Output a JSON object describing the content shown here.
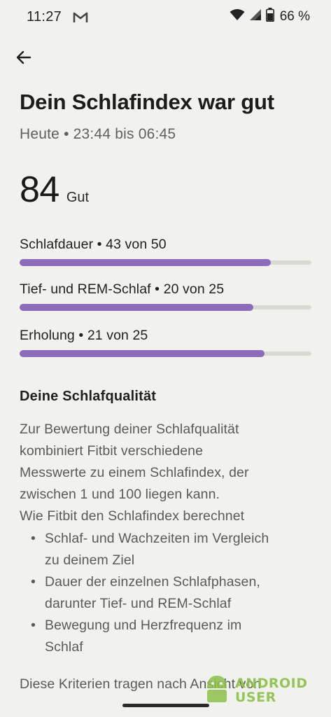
{
  "status_bar": {
    "time": "11:27",
    "battery_percent": "66 %",
    "icons": [
      "gmail-icon",
      "wifi-icon",
      "signal-icon",
      "battery-icon"
    ]
  },
  "header": {
    "back_icon": "arrow-back-icon",
    "title": "Dein Schlafindex war gut",
    "subtitle": "Heute • 23:44 bis 06:45"
  },
  "score": {
    "value": "84",
    "label": "Gut"
  },
  "metrics": [
    {
      "label": "Schlafdauer • 43 von 50",
      "score": 43,
      "max": 50
    },
    {
      "label": "Tief- und REM-Schlaf • 20 von 25",
      "score": 20,
      "max": 25
    },
    {
      "label": "Erholung • 21 von 25",
      "score": 21,
      "max": 25
    }
  ],
  "quality": {
    "heading": "Deine Schlafqualität",
    "lines": [
      "Zur Bewertung deiner Schlafqualität",
      "kombiniert Fitbit verschiedene",
      "Messwerte zu einem Schlafindex, der",
      "zwischen 1 und 100 liegen kann.",
      "Wie Fitbit den Schlafindex berechnet"
    ],
    "bullets": [
      [
        "Schlaf- und Wachzeiten im Vergleich",
        "zu deinem Ziel"
      ],
      [
        "Dauer der einzelnen Schlafphasen,",
        "darunter Tief- und REM-Schlaf"
      ],
      [
        "Bewegung und Herzfrequenz im",
        "Schlaf"
      ]
    ],
    "footer": "Diese Kriterien tragen nach Ansicht von"
  },
  "watermark": {
    "line1": "ANDROID",
    "line2": "USER"
  },
  "colors": {
    "background": "#f1f2ed",
    "accent_purple": "#8e6bb8",
    "track": "#d9dad4",
    "watermark_green": "#8cc04a"
  }
}
